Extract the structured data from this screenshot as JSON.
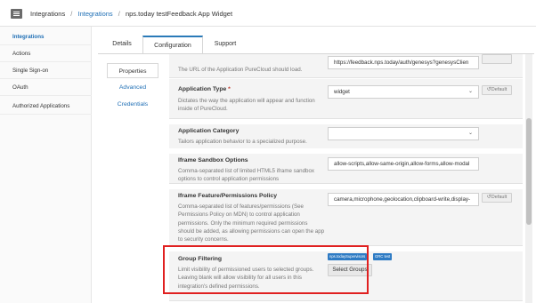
{
  "breadcrumb": {
    "root": "Integrations",
    "parent": "Integrations",
    "current": "nps.today testFeedback App Widget",
    "separator": "/"
  },
  "sidebar": {
    "items": [
      {
        "label": "Integrations",
        "active": true
      },
      {
        "label": "Actions",
        "active": false
      },
      {
        "label": "Single Sign-on",
        "active": false
      },
      {
        "label": "OAuth",
        "active": false
      },
      {
        "label": "Authorized Applications",
        "active": false
      }
    ]
  },
  "tabs": [
    {
      "label": "Details",
      "active": false
    },
    {
      "label": "Configuration",
      "active": true
    },
    {
      "label": "Support",
      "active": false
    }
  ],
  "subtabs": [
    {
      "label": "Properties",
      "active": true
    },
    {
      "label": "Advanced",
      "active": false
    },
    {
      "label": "Credentials",
      "active": false
    }
  ],
  "settings": {
    "url_row": {
      "desc": "The URL of the Application PureCloud should load.",
      "value": "https://feedback.nps.today/auth/genesys?genesysClien"
    },
    "app_type": {
      "label": "Application Type",
      "required_mark": "*",
      "desc": "Dictates the way the application will appear and function inside of PureCloud.",
      "value": "widget",
      "default_label": "Default"
    },
    "app_category": {
      "label": "Application Category",
      "desc": "Tailors application behavior to a specialized purpose.",
      "value": ""
    },
    "sandbox": {
      "label": "Iframe Sandbox Options",
      "desc": "Comma-separated list of limited HTML5 iframe sandbox options to control application permissions",
      "value": "allow-scripts,allow-same-origin,allow-forms,allow-modal"
    },
    "permissions": {
      "label": "Iframe Feature/Permissions Policy",
      "desc": "Comma-separated list of features/permissions (See Permissions Policy on MDN) to control application permissions. Only the minimum required permissions should be added, as allowing permissions can open the app to security concerns.",
      "value": "camera,microphone,geolocation,clipboard-write,display-",
      "default_label": "Default"
    },
    "group_filtering": {
      "label": "Group Filtering",
      "desc": "Limit visibility of permissioned users to selected groups. Leaving blank will allow visibility for all users in this integration's defined permissions.",
      "tags": [
        "nps.todaySupervisors",
        "GRC test"
      ],
      "button": "Select Groups"
    }
  },
  "colors": {
    "accent": "#1f6fb5",
    "tab_border": "#2a7ab8",
    "highlight": "#e02020",
    "tag_bg": "#2e7bc4"
  },
  "icons": {
    "menu": "grid-menu-icon",
    "undo": "undo-icon",
    "dropdown": "chevron-down-icon"
  }
}
